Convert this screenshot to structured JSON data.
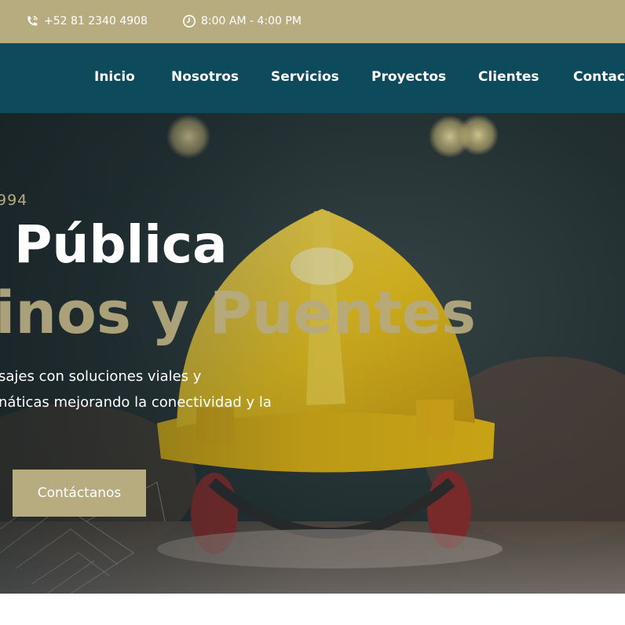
{
  "topbar": {
    "phone": "+52 81 2340 4908",
    "hours": "8:00 AM - 4:00 PM",
    "phone_icon": "phone-icon",
    "clock_icon": "clock-icon"
  },
  "nav": {
    "items": [
      {
        "label": "Inicio"
      },
      {
        "label": "Nosotros"
      },
      {
        "label": "Servicios"
      },
      {
        "label": "Proyectos"
      },
      {
        "label": "Clientes"
      },
      {
        "label": "Contacto"
      }
    ]
  },
  "hero": {
    "eyebrow": "994",
    "title_line1": "Pública",
    "title_line2": "inos y Puentes",
    "description_line1": "sajes con soluciones viales y",
    "description_line2": "náticas mejorando la conectividad y la",
    "cta_label": "Contáctanos"
  },
  "colors": {
    "accent": "#b7ab80",
    "nav_bg": "#0c4a5c",
    "helmet": "#f2c81c"
  }
}
